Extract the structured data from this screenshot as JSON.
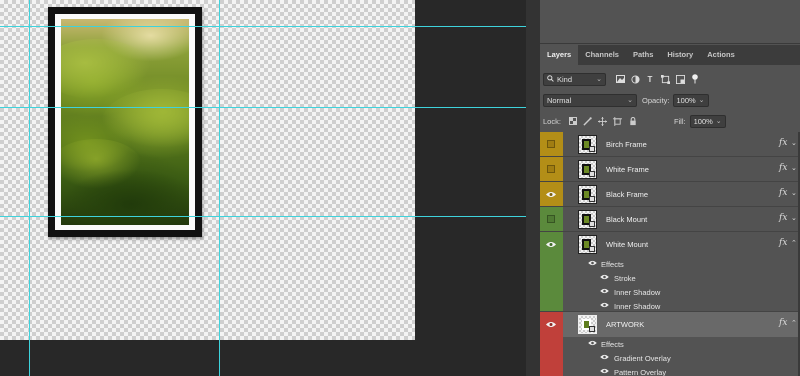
{
  "panel": {
    "tabs": [
      {
        "label": "Layers",
        "active": true
      },
      {
        "label": "Channels",
        "active": false
      },
      {
        "label": "Paths",
        "active": false
      },
      {
        "label": "History",
        "active": false
      },
      {
        "label": "Actions",
        "active": false
      }
    ],
    "filter": {
      "label": "Kind",
      "icons": [
        "image-filter-icon",
        "adjustment-filter-icon",
        "type-filter-icon",
        "shape-filter-icon",
        "smart-object-filter-icon",
        "filter-toggle-icon"
      ]
    },
    "blend_mode": "Normal",
    "opacity_label": "Opacity:",
    "opacity_value": "100%",
    "lock_label": "Lock:",
    "lock_icons": [
      "lock-transparent-icon",
      "lock-paint-icon",
      "lock-position-icon",
      "lock-artboard-icon",
      "lock-all-icon"
    ],
    "fill_label": "Fill:",
    "fill_value": "100%"
  },
  "layers": [
    {
      "name": "Birch Frame",
      "color": "#b38e17",
      "visible": false,
      "fx": "fx"
    },
    {
      "name": "White Frame",
      "color": "#b38e17",
      "visible": false,
      "fx": "fx"
    },
    {
      "name": "Black Frame",
      "color": "#b38e17",
      "visible": true,
      "fx": "fx"
    },
    {
      "name": "Black Mount",
      "color": "#5b8a3c",
      "visible": false,
      "fx": "fx"
    },
    {
      "name": "White Mount",
      "color": "#5b8a3c",
      "visible": true,
      "fx": "fx",
      "expanded": true
    },
    {
      "name": "ARTWORK",
      "color": "#c0403a",
      "visible": true,
      "fx": "fx",
      "expanded": true,
      "selected": true
    }
  ],
  "white_mount_effects": {
    "title": "Effects",
    "items": [
      "Stroke",
      "Inner Shadow",
      "Inner Shadow"
    ]
  },
  "artwork_effects": {
    "title": "Effects",
    "items": [
      "Gradient Overlay",
      "Pattern Overlay"
    ]
  },
  "colors": {
    "guide": "#3fd3dc",
    "panel_bg": "#535353",
    "yellow_label": "#b38e17",
    "green_label": "#5b8a3c",
    "red_label": "#c0403a"
  }
}
